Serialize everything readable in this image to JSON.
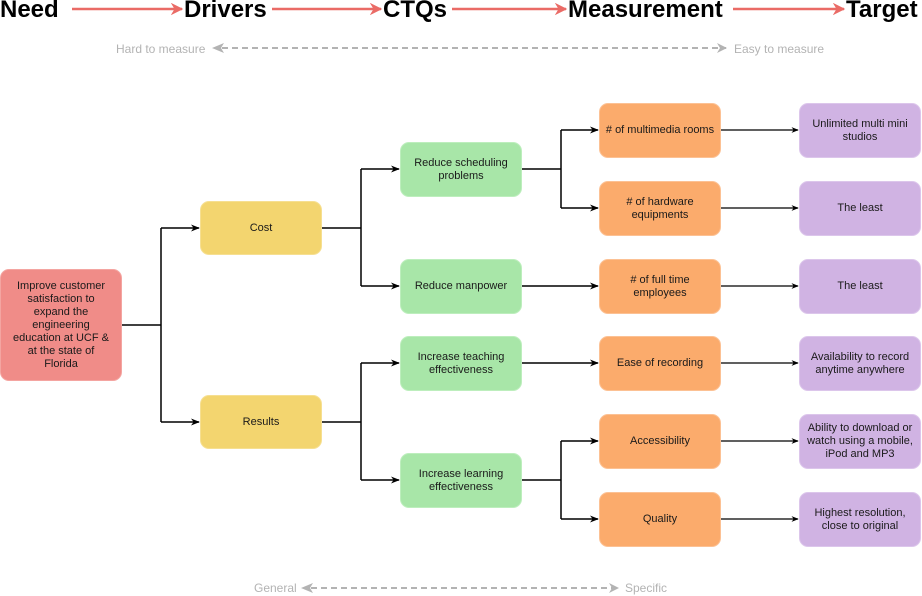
{
  "header": {
    "stages": [
      "Need",
      "Drivers",
      "CTQs",
      "Measurement",
      "Target"
    ],
    "arrow_color": "#ea6b66"
  },
  "scales": {
    "measurability": {
      "left": "Hard to measure",
      "right": "Easy to measure"
    },
    "specificity": {
      "left": "General",
      "right": "Specific"
    },
    "color": "#b3b3b3"
  },
  "colors": {
    "need": "#f08c88",
    "driver": "#f3d56f",
    "ctq": "#a8e6a8",
    "measurement": "#fbab6c",
    "target": "#d0b3e3",
    "connector": "#000000"
  },
  "tree": {
    "need": "Improve customer satisfaction to expand the engineering education at UCF & at the state of Florida",
    "drivers": [
      {
        "label": "Cost",
        "ctqs": [
          {
            "label": "Reduce scheduling problems",
            "measurements": [
              {
                "label": "# of multimedia rooms",
                "target": "Unlimited multi mini studios"
              },
              {
                "label": "# of hardware equipments",
                "target": "The least"
              }
            ]
          },
          {
            "label": "Reduce manpower",
            "measurements": [
              {
                "label": "# of full time employees",
                "target": "The least"
              }
            ]
          }
        ]
      },
      {
        "label": "Results",
        "ctqs": [
          {
            "label": "Increase teaching effectiveness",
            "measurements": [
              {
                "label": "Ease of recording",
                "target": "Availability to record anytime anywhere"
              }
            ]
          },
          {
            "label": "Increase learning effectiveness",
            "measurements": [
              {
                "label": "Accessibility",
                "target": "Ability to download or watch using a mobile, iPod and MP3"
              },
              {
                "label": "Quality",
                "target": "Highest resolution, close to original"
              }
            ]
          }
        ]
      }
    ]
  }
}
